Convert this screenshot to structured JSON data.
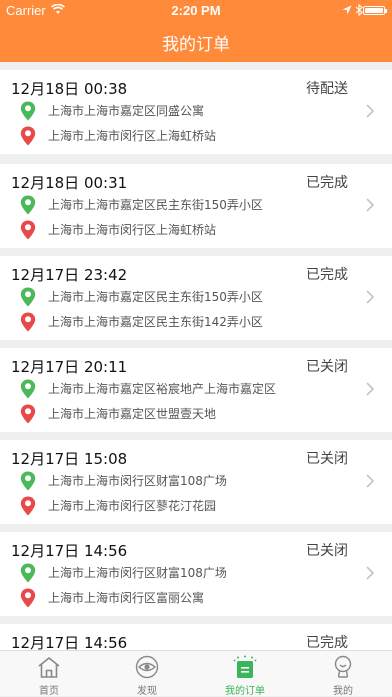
{
  "status_bar": {
    "carrier": "Carrier",
    "time": "2:20 PM"
  },
  "header": {
    "title": "我的订单"
  },
  "orders": [
    {
      "time": "12月18日 00:38",
      "status": "待配送",
      "from": "上海市上海市嘉定区同盛公寓",
      "to": "上海市上海市闵行区上海虹桥站"
    },
    {
      "time": "12月18日 00:31",
      "status": "已完成",
      "from": "上海市上海市嘉定区民主东街150弄小区",
      "to": "上海市上海市闵行区上海虹桥站"
    },
    {
      "time": "12月17日 23:42",
      "status": "已完成",
      "from": "上海市上海市嘉定区民主东街150弄小区",
      "to": "上海市上海市嘉定区民主东街142弄小区"
    },
    {
      "time": "12月17日 20:11",
      "status": "已关闭",
      "from": "上海市上海市嘉定区裕宸地产上海市嘉定区",
      "to": "上海市上海市嘉定区世盟壹天地"
    },
    {
      "time": "12月17日 15:08",
      "status": "已关闭",
      "from": "上海市上海市闵行区财富108广场",
      "to": "上海市上海市闵行区蓼花汀花园"
    },
    {
      "time": "12月17日 14:56",
      "status": "已关闭",
      "from": "上海市上海市闵行区财富108广场",
      "to": "上海市上海市闵行区富丽公寓"
    },
    {
      "time": "12月17日 14:56",
      "status": "已完成",
      "from": "",
      "to": ""
    }
  ],
  "tabbar": {
    "items": [
      {
        "label": "首页",
        "icon": "home-icon"
      },
      {
        "label": "发现",
        "icon": "eye-icon"
      },
      {
        "label": "我的订单",
        "icon": "orders-icon",
        "active": true
      },
      {
        "label": "我的",
        "icon": "profile-icon"
      }
    ]
  },
  "colors": {
    "header": "#ff8a3a",
    "pin_start": "#4bb85a",
    "pin_end": "#e84a4a",
    "tab_active": "#3cb55a"
  }
}
